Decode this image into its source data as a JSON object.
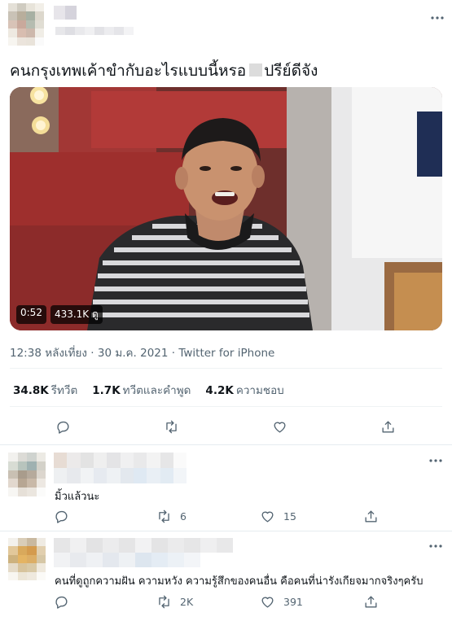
{
  "tweet": {
    "text": "คนกรุงเทพเค้าขำกับอะไรแบบนี้หรอ",
    "text_tail": "ปรีย์ดีจัง",
    "video": {
      "duration": "0:52",
      "views": "433.1K ดู"
    },
    "meta": "12:38 หลังเที่ยง · 30 ม.ค. 2021 · Twitter for iPhone",
    "stats": {
      "retweets": {
        "value": "34.8K",
        "label": "รีทวีต"
      },
      "quotes": {
        "value": "1.7K",
        "label": "ทวีตและคำพูด"
      },
      "likes": {
        "value": "4.2K",
        "label": "ความชอบ"
      }
    },
    "more_icon": "more-horizontal-icon"
  },
  "replies": [
    {
      "text": "มิ้วแล้วนะ",
      "retweet_count": "6",
      "like_count": "15"
    },
    {
      "text": "คนที่ดูถูกความฝัน ความหวัง ความรู้สึกของคนอื่น คือคนที่น่ารังเกียจมากจริงๆครับ",
      "retweet_count": "2K",
      "like_count": "391"
    }
  ],
  "icons": {
    "reply": "reply-icon",
    "retweet": "retweet-icon",
    "like": "heart-icon",
    "share": "share-icon"
  },
  "colors": {
    "text": "#0f1419",
    "secondary": "#536471",
    "divider": "#eff3f4"
  }
}
